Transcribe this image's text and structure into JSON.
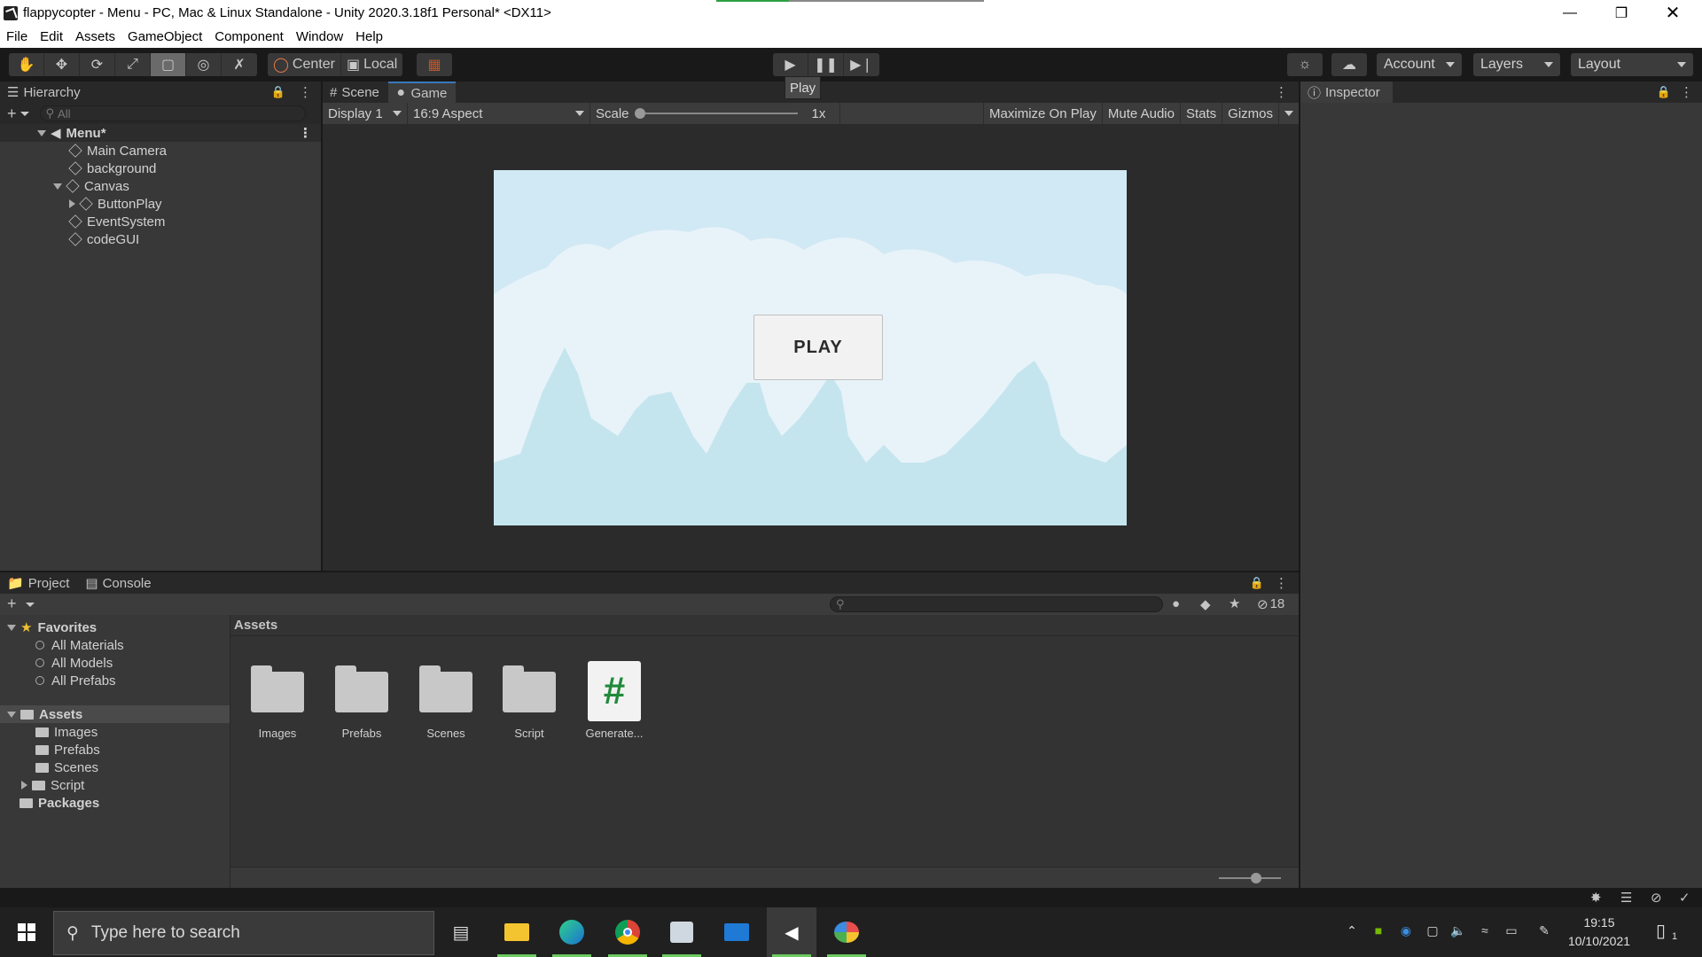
{
  "window": {
    "title": "flappycopter - Menu - PC, Mac & Linux Standalone - Unity 2020.3.18f1 Personal* <DX11>",
    "progress": 0.27,
    "controls": [
      "minimize",
      "restore",
      "close"
    ]
  },
  "menu": [
    "File",
    "Edit",
    "Assets",
    "GameObject",
    "Component",
    "Window",
    "Help"
  ],
  "toolbar": {
    "tools": [
      "hand-tool",
      "move-tool",
      "rotate-tool",
      "scale-tool",
      "rect-tool",
      "transform-tool",
      "custom-tool"
    ],
    "active_tool": "rect-tool",
    "pivot": "Center",
    "space": "Local",
    "account": "Account",
    "layers": "Layers",
    "layout": "Layout",
    "tooltip": "Play"
  },
  "hierarchy": {
    "tab": "Hierarchy",
    "search_placeholder": "All",
    "scene": "Menu*",
    "items": [
      {
        "label": "Main Camera",
        "depth": 1
      },
      {
        "label": "background",
        "depth": 1
      },
      {
        "label": "Canvas",
        "depth": 1
      },
      {
        "label": "ButtonPlay",
        "depth": 2
      },
      {
        "label": "EventSystem",
        "depth": 1
      },
      {
        "label": "codeGUI",
        "depth": 1
      }
    ]
  },
  "gameview": {
    "tabs": [
      "Scene",
      "Game"
    ],
    "active_tab": "Game",
    "display": "Display 1",
    "aspect": "16:9 Aspect",
    "scale_label": "Scale",
    "scale_value": "1x",
    "maximize": "Maximize On Play",
    "mute": "Mute Audio",
    "stats": "Stats",
    "gizmos": "Gizmos",
    "play_button": "PLAY"
  },
  "inspector": {
    "tab": "Inspector"
  },
  "project": {
    "tabs": [
      "Project",
      "Console"
    ],
    "hidden_count": "18",
    "breadcrumb": "Assets",
    "favorites_label": "Favorites",
    "favorites": [
      "All Materials",
      "All Models",
      "All Prefabs"
    ],
    "assets_label": "Assets",
    "asset_folders": [
      "Images",
      "Prefabs",
      "Scenes",
      "Script"
    ],
    "packages_label": "Packages",
    "grid_items": [
      {
        "label": "Images",
        "kind": "folder"
      },
      {
        "label": "Prefabs",
        "kind": "folder"
      },
      {
        "label": "Scenes",
        "kind": "folder"
      },
      {
        "label": "Script",
        "kind": "folder"
      },
      {
        "label": "Generate...",
        "kind": "script"
      }
    ]
  },
  "taskbar": {
    "search_placeholder": "Type here to search",
    "time": "19:15",
    "date": "10/10/2021",
    "notification_count": "1"
  },
  "colors": {
    "accent": "#3a79bb",
    "sky": "#d1e9f4",
    "taskbar_indicator": "#6ccb5f",
    "script_hash": "#1f8a3b"
  }
}
